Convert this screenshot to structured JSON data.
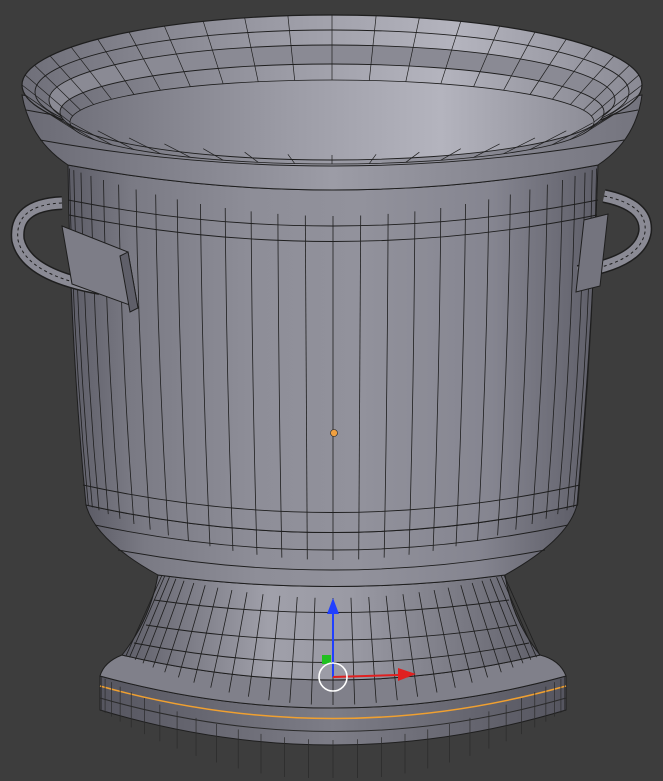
{
  "viewport": {
    "background": "#3d3d3d",
    "object": "urn-mesh",
    "display_mode": "solid-wireframe",
    "mesh_color": "#8c8c96",
    "wire_color": "#1e1e1e",
    "selected_edge_color": "#f0a030",
    "origin_color": "#f0a040"
  },
  "gizmo": {
    "type": "translate-manipulator",
    "axis_x_color": "#e02020",
    "axis_y_color": "#20c020",
    "axis_z_color": "#2040ff",
    "view_circle_color": "#ffffff"
  },
  "icons": [
    "origin-dot-icon",
    "translate-gizmo-icon"
  ]
}
